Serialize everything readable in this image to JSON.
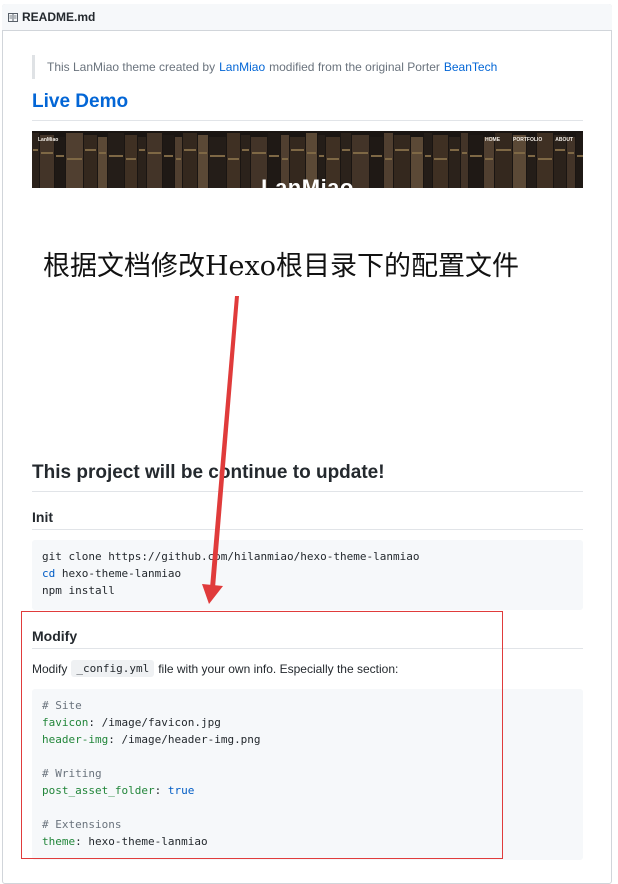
{
  "file_header": {
    "icon": "book-icon",
    "filename": "README.md"
  },
  "intro": {
    "before": "This LanMiao theme created by",
    "author_link": "LanMiao",
    "middle": "modified from the original Porter",
    "origin_link": "BeanTech"
  },
  "live_demo_heading": "Live Demo",
  "banner": {
    "brand": "LanMiao",
    "menu": [
      "HOME",
      "PORTFOLIO",
      "ABOUT"
    ],
    "title": "LanMiao"
  },
  "annotation": {
    "text": "根据文档修改Hexo根目录下的配置文件",
    "arrow_color": "#e03b3b"
  },
  "project_heading": "This project will be continue to update!",
  "init_heading": "Init",
  "init_code": {
    "line1": "git clone https://github.com/hilanmiao/hexo-theme-lanmiao",
    "line2_cmd": "cd",
    "line2_rest": " hexo-theme-lanmiao",
    "line3": "npm install"
  },
  "modify_heading": "Modify",
  "modify_para": {
    "before": "Modify",
    "code": "_config.yml",
    "after": "file with your own info. Especially the section:"
  },
  "config_code": {
    "site_comment": "# Site",
    "favicon_key": "favicon",
    "favicon_val": ": /image/favicon.jpg",
    "header_key": "header-img",
    "header_val": ": /image/header-img.png",
    "writing_comment": "# Writing",
    "post_key": "post_asset_folder",
    "post_sep": ": ",
    "post_val": "true",
    "ext_comment": "# Extensions",
    "theme_key": "theme",
    "theme_val": ": hexo-theme-lanmiao"
  },
  "colors": {
    "link": "#0366d6",
    "annotation_red": "#e03b3b",
    "code_bg": "#f6f8fa"
  }
}
